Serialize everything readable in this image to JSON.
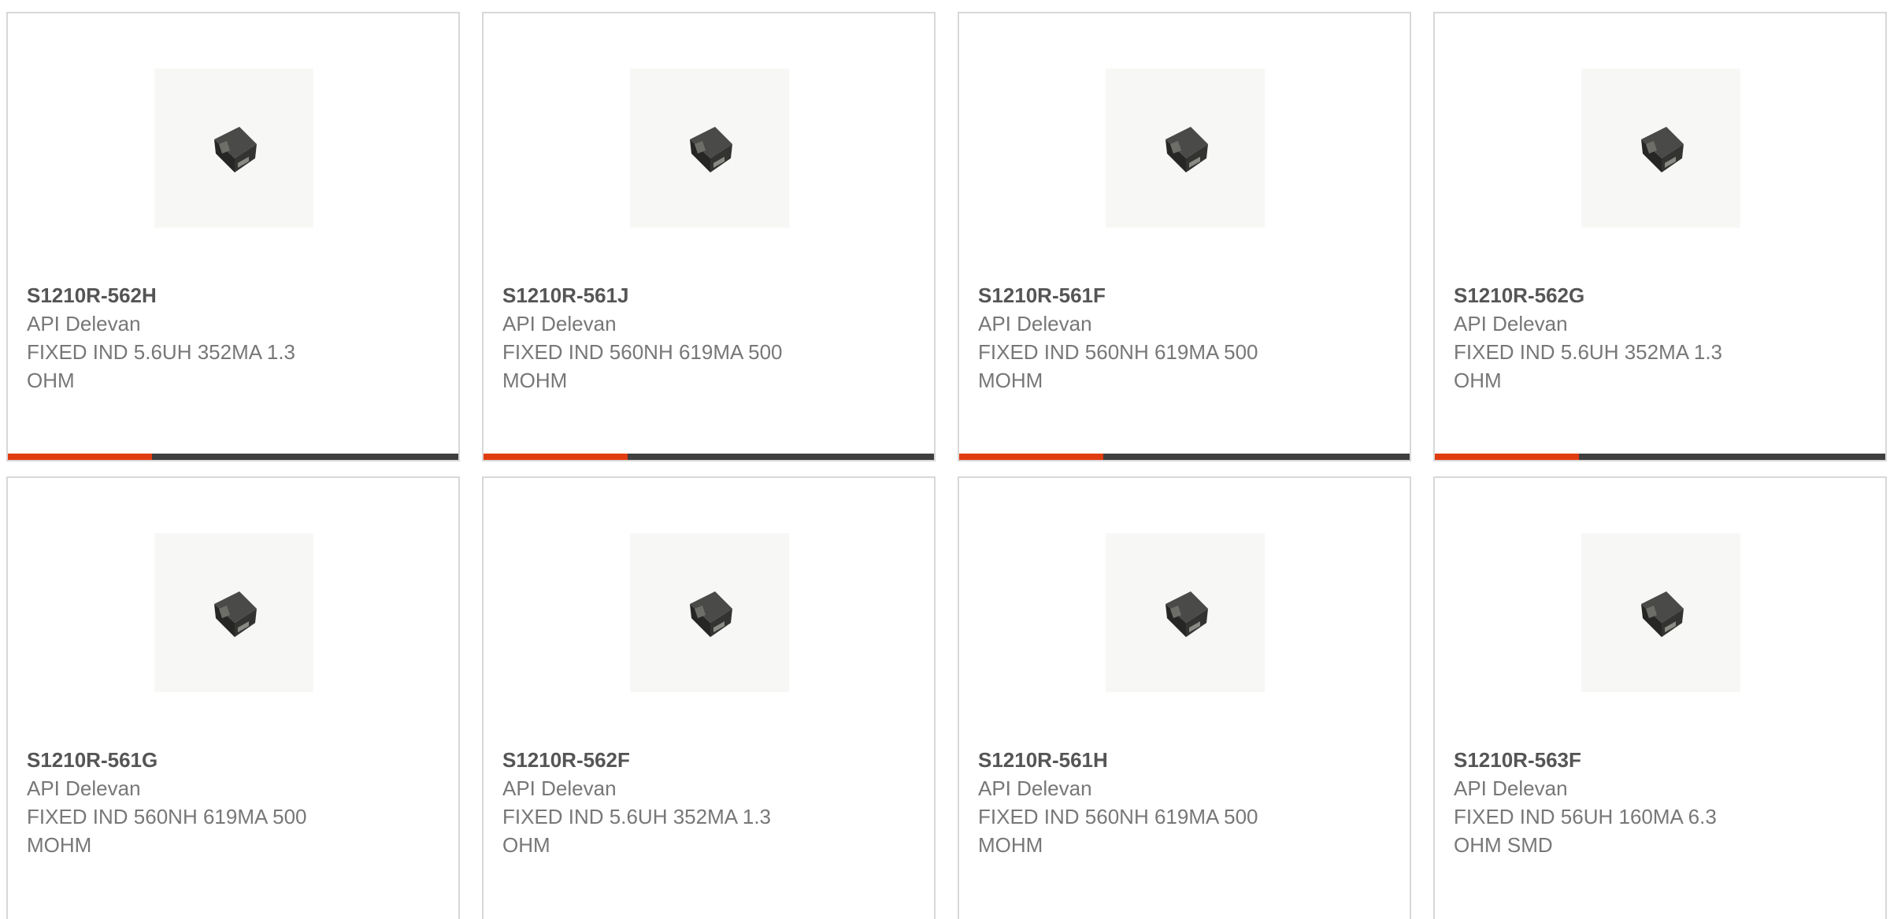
{
  "accent_color": "#e03c10",
  "track_color": "#3f3f3f",
  "products": [
    {
      "part_number": "S1210R-562H",
      "manufacturer": "API Delevan",
      "description": "FIXED IND 5.6UH 352MA 1.3 OHM",
      "image_icon": "inductor-chip-icon",
      "progress_fraction": 0.32
    },
    {
      "part_number": "S1210R-561J",
      "manufacturer": "API Delevan",
      "description": "FIXED IND 560NH 619MA 500 MOHM",
      "image_icon": "inductor-chip-icon",
      "progress_fraction": 0.32
    },
    {
      "part_number": "S1210R-561F",
      "manufacturer": "API Delevan",
      "description": "FIXED IND 560NH 619MA 500 MOHM",
      "image_icon": "inductor-chip-icon",
      "progress_fraction": 0.32
    },
    {
      "part_number": "S1210R-562G",
      "manufacturer": "API Delevan",
      "description": "FIXED IND 5.6UH 352MA 1.3 OHM",
      "image_icon": "inductor-chip-icon",
      "progress_fraction": 0.32
    },
    {
      "part_number": "S1210R-561G",
      "manufacturer": "API Delevan",
      "description": "FIXED IND 560NH 619MA 500 MOHM",
      "image_icon": "inductor-chip-icon"
    },
    {
      "part_number": "S1210R-562F",
      "manufacturer": "API Delevan",
      "description": "FIXED IND 5.6UH 352MA 1.3 OHM",
      "image_icon": "inductor-chip-icon"
    },
    {
      "part_number": "S1210R-561H",
      "manufacturer": "API Delevan",
      "description": "FIXED IND 560NH 619MA 500 MOHM",
      "image_icon": "inductor-chip-icon"
    },
    {
      "part_number": "S1210R-563F",
      "manufacturer": "API Delevan",
      "description": "FIXED IND 56UH 160MA 6.3 OHM SMD",
      "image_icon": "inductor-chip-icon"
    }
  ]
}
